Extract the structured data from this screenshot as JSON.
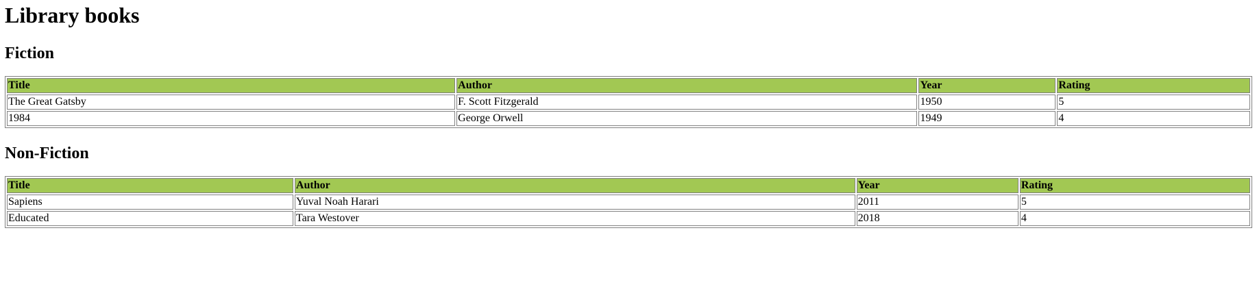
{
  "page": {
    "title": "Library books"
  },
  "sections": [
    {
      "heading": "Fiction",
      "columns": [
        "Title",
        "Author",
        "Year",
        "Rating"
      ],
      "rows": [
        [
          "The Great Gatsby",
          "F. Scott Fitzgerald",
          "1950",
          "5"
        ],
        [
          "1984",
          "George Orwell",
          "1949",
          "4"
        ]
      ]
    },
    {
      "heading": "Non-Fiction",
      "columns": [
        "Title",
        "Author",
        "Year",
        "Rating"
      ],
      "rows": [
        [
          "Sapiens",
          "Yuval Noah Harari",
          "2011",
          "5"
        ],
        [
          "Educated",
          "Tara Westover",
          "2018",
          "4"
        ]
      ]
    }
  ],
  "colors": {
    "header_bg": "#a2c853",
    "border": "#808080"
  }
}
